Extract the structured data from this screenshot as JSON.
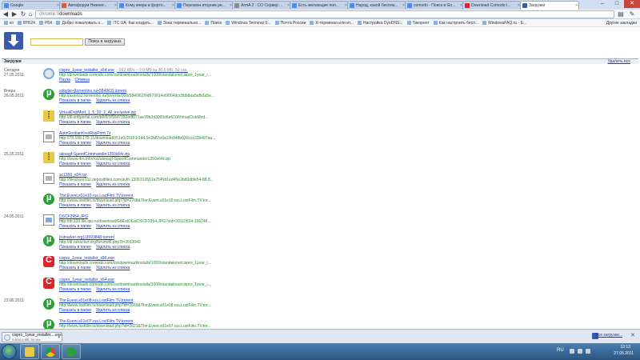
{
  "browser": {
    "tabs": [
      {
        "label": "Google",
        "color": "#4a8af4"
      },
      {
        "label": "Автофорум Нижнег...",
        "color": "#e05a2b"
      },
      {
        "label": "Кому вчера в форто...",
        "color": "#4a8af4"
      },
      {
        "label": "Перезвон вторник ре...",
        "color": "#4a8af4"
      },
      {
        "label": "ArmA 2 : CO Сервер ...",
        "color": "#8a8a8a"
      },
      {
        "label": "Есть желающие поп...",
        "color": "#4a8af4"
      },
      {
        "label": "Народ, какой беспла...",
        "color": "#4a8af4"
      },
      {
        "label": "comodo - Поиск в Go...",
        "color": "#4a8af4"
      },
      {
        "label": "Download Comodo I...",
        "color": "#d8242b"
      },
      {
        "label": "Загрузки",
        "color": "#3a5ca8"
      }
    ],
    "address_scheme": "chrome://",
    "address_path": "downloads",
    "bookmarks": [
      "ко",
      "ВТБ24",
      "РБК",
      "Добро пожаловать н...",
      "ITC.UA: Как создать...",
      "Зона терминально...",
      "Поиск",
      "Windows Terminal S...",
      "Почта России",
      "Х-терминал или ит...",
      "Настройка DynDNS...",
      "Тикорент",
      "Как настроить бесп...",
      "WindowsFAQ.ru - Е..."
    ],
    "other_bookmarks": "Другие закладки"
  },
  "downloads": {
    "search_button": "Поиск в загрузках",
    "search_value": "",
    "section_title": "Загрузки",
    "clear_all": "Удалить все",
    "show_in_folder": "Показать в папке",
    "remove_from_list": "Удалить из списка",
    "groups": [
      {
        "date_label": "Сегодня",
        "date": "27.05.2011"
      },
      {
        "date_label": "Вчера",
        "date": "26.05.2011"
      },
      {
        "date_label": "",
        "date": "25.05.2011"
      },
      {
        "date_label": "",
        "date": "24.05.2011"
      },
      {
        "date_label": "",
        "date": "23.05.2011"
      }
    ],
    "items": [
      {
        "name": "cispro_1year_installer_x64.exe",
        "status": "- 563 kB/s – 9.8 МБ из 30.6 МБ, 50 сек.",
        "url": "http://downloads.comodo.com/cis/download/installs/1000/standalone/cispro_1year_i...",
        "actions": [
          "Пауза",
          "Отмена"
        ]
      },
      {
        "name": "sobytie+[torrentino.ru+584962].torrent",
        "status": "",
        "url": "http://assets2.torrentino.ru/torrents/000/584/962/0d670614e6f0049cc5bb8aa5afb2a5e...",
        "actions": []
      },
      {
        "name": "VirtualDubMod_1_5_10_2_All_inclusive.zip",
        "status": "",
        "url": "http://dl.softportal.com/b8/8/0/50d7350edf071ae78b2d3093d6e610/VirtualDubMod...",
        "actions": []
      },
      {
        "name": "AutoGordianKnotRusPortt.7z",
        "status": "",
        "url": "http://78.108.179.11/download/051e0/26161/144.5e3b87e0a19b948b030ccc229407aa...",
        "actions": []
      },
      {
        "name": "alexagf-SpeedCommander1350x64r.zip",
        "status": "",
        "url": "http://www.4ro.info/rus/alexagf-SpeedCommander1350x64r.zip",
        "actions": []
      },
      {
        "name": "sc1350_x64.rar",
        "status": "",
        "url": "http://fileshare102.depositfiles.com/auth-1306312661a7549d1ed45e2bd9dbfe54-88.8...",
        "actions": []
      },
      {
        "name": "The.Event.s01e10.rus.LostFilm.TV.torrent",
        "status": "",
        "url": "http://www.lostfilm.tv/download.php?id=2708&The.Event.s01e10.rus.LostFilm.TV.tor...",
        "actions": []
      },
      {
        "name": "DSCF2954.JPG",
        "status": "",
        "url": "http://dc133.file.qip.ru/download/G8EalOEa/DSCF2954.JPG?sid=20110524-106748...",
        "actions": []
      },
      {
        "name": "[rutracker.org].t3593848.torrent",
        "status": "",
        "url": "http://dl.rutracker.org/forum/dl.php?t=3593040",
        "actions": []
      },
      {
        "name": "cispro_1year_installer_x86.exe",
        "status": "",
        "url": "http://downloads.comodo.com/cis/download/installs/1000/standalone/cispro_1year_i...",
        "actions": []
      },
      {
        "name": "cispro_1year_installer_x64.exe",
        "status": "",
        "url": "http://downloads.comodo.com/cis/download/installs/1000/standalone/cispro_1year_i...",
        "actions": []
      },
      {
        "name": "The.Event.s01e08.rus.LostFilm.TV.torrent",
        "status": "",
        "url": "http://www.lostfilm.tv/download.php?id=2669&The.Event.s01e08.rus.LostFilm.TV.tor...",
        "actions": []
      },
      {
        "name": "The.Event.s01e07.rus.LostFilm.TV.torrent",
        "status": "",
        "url": "http://www.lostfilm.tv/download.php?id=2621&The.Event.s01e07.rus.LostFilm.TV.tor...",
        "actions": []
      }
    ]
  },
  "shelf": {
    "name": "cispro_1year_installer....exe",
    "status": "9.8/30.6 МБ, 50 сек.",
    "show_all": "Все загрузки..."
  },
  "taskbar": {
    "lang": "RU",
    "time": "12:13",
    "date": "27.05.2011"
  }
}
